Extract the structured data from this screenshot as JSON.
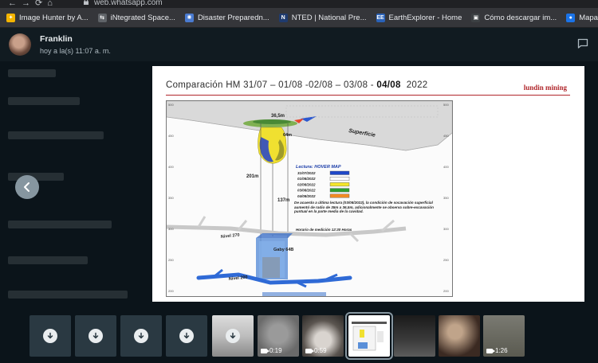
{
  "browser": {
    "url": "web.whatsapp.com",
    "bookmarks": [
      {
        "label": "Image Hunter by A...",
        "color": "#f4b400",
        "glyph": "✦"
      },
      {
        "label": "iNtegrated Space...",
        "color": "#5f6368",
        "glyph": "⇆"
      },
      {
        "label": "Disaster Preparedn...",
        "color": "#4a7bd0",
        "glyph": "✺"
      },
      {
        "label": "NTED | National Pre...",
        "color": "#1f3b6e",
        "glyph": "N"
      },
      {
        "label": "EarthExplorer - Home",
        "color": "#2a62b8",
        "glyph": "EE"
      },
      {
        "label": "Cómo descargar im...",
        "color": "#3c4043",
        "glyph": "▣"
      },
      {
        "label": "Mapa Google - Coo...",
        "color": "#1a73e8",
        "glyph": "●"
      }
    ]
  },
  "viewer": {
    "sender": "Franklin",
    "timestamp": "hoy a la(s) 11:07 a. m."
  },
  "slide": {
    "title_prefix": "Comparación HM 31/07 – 01/08 -02/08 – 03/08 - ",
    "title_bold": "04/08",
    "title_suffix": "2022",
    "brand": "lundin mining"
  },
  "diagram": {
    "label_top": "36,5m",
    "label_width": "64m",
    "label_depth1": "201m",
    "label_depth2": "137m",
    "label_surface": "Superficie",
    "label_level270": "Nivel 270",
    "label_gaby": "Gaby 64B",
    "label_level200": "Nivel 200",
    "legend_title": "Lectura: HOVER MAP",
    "legend": [
      {
        "date": "31/07/2022",
        "color": "#1f48c8"
      },
      {
        "date": "01/08/2022",
        "color": "#ffffff"
      },
      {
        "date": "02/08/2022",
        "color": "#f4e62a"
      },
      {
        "date": "03/08/2022",
        "color": "#2e9e2e"
      },
      {
        "date": "04/08/2022",
        "color": "#f08a24"
      }
    ],
    "note": "De acuerdo a última lectura (03/08/2022), la condición de socavación superficial aumentó de radio de 35m a 36,5m, adicionalmente se observa sobre-excavación puntual en la parte media de la cavidad.",
    "time_note": "Horario de medición 12:30 Horas",
    "y_ticks": [
      "500",
      "450",
      "400",
      "350",
      "300",
      "250",
      "200"
    ]
  },
  "thumbnails": [
    {
      "kind": "download"
    },
    {
      "kind": "download"
    },
    {
      "kind": "download"
    },
    {
      "kind": "download"
    },
    {
      "kind": "photo-download"
    },
    {
      "kind": "video",
      "duration": "0:19"
    },
    {
      "kind": "video",
      "duration": "0:59"
    },
    {
      "kind": "current"
    },
    {
      "kind": "photo"
    },
    {
      "kind": "photo"
    },
    {
      "kind": "video",
      "duration": "1:26"
    }
  ]
}
